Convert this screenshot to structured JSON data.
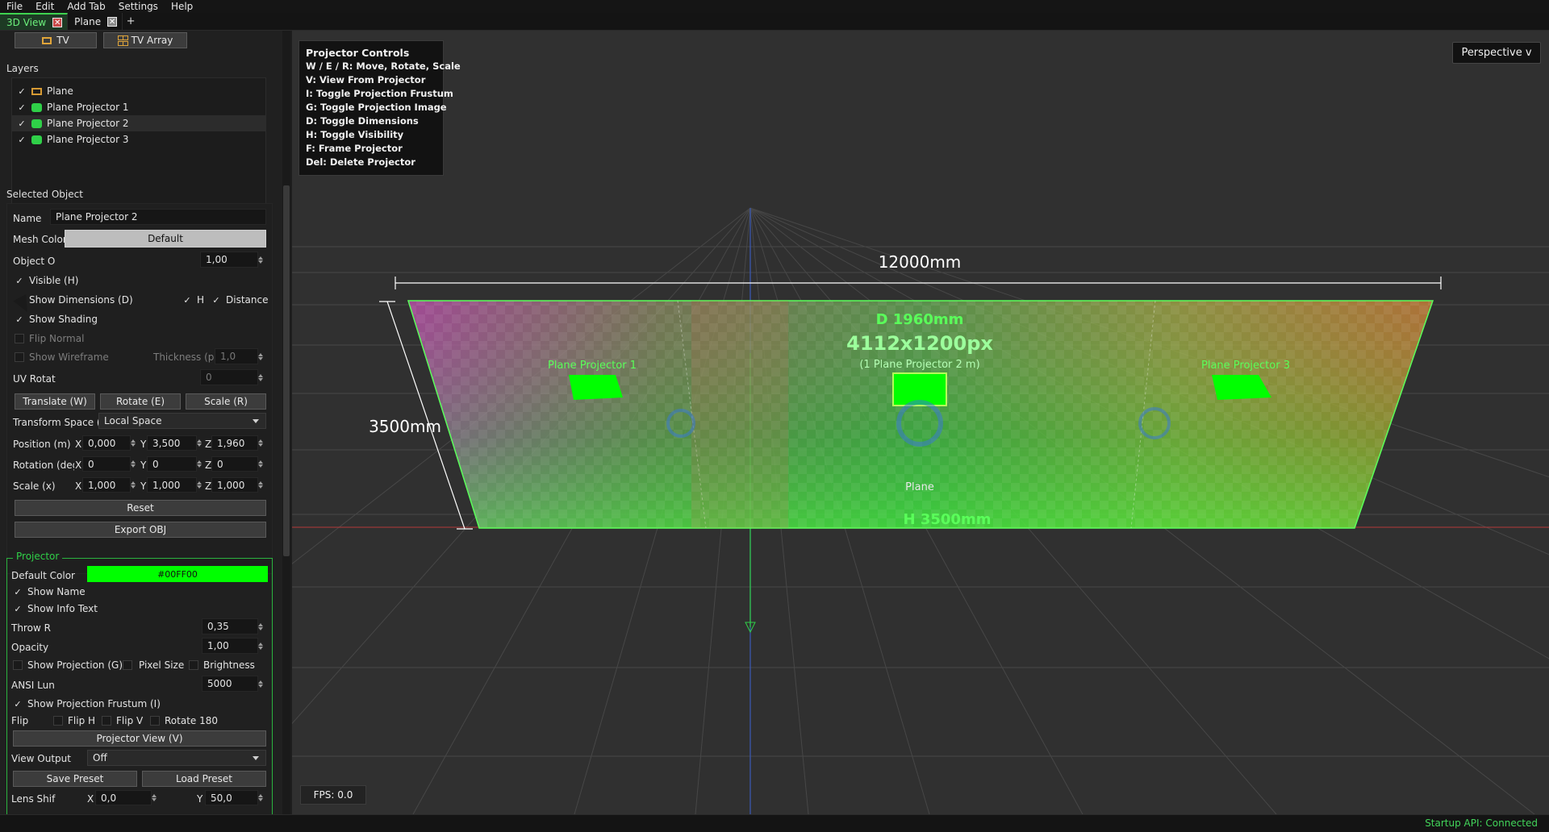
{
  "menu": [
    "File",
    "Edit",
    "Add Tab",
    "Settings",
    "Help"
  ],
  "tabs": [
    {
      "label": "3D View",
      "active": true
    },
    {
      "label": "Plane",
      "active": false
    }
  ],
  "tab_add_label": "+",
  "toolbar": {
    "tv_label": "TV",
    "tv_array_label": "TV Array"
  },
  "layers": {
    "title": "Layers",
    "items": [
      {
        "label": "Plane",
        "checked": true,
        "icon": "plane-layer-icon",
        "selected": false
      },
      {
        "label": "Plane Projector 1",
        "checked": true,
        "icon": "projector-icon",
        "selected": false
      },
      {
        "label": "Plane Projector 2",
        "checked": true,
        "icon": "projector-icon",
        "selected": true
      },
      {
        "label": "Plane Projector 3",
        "checked": true,
        "icon": "projector-icon",
        "selected": false
      }
    ]
  },
  "selected_object": {
    "title": "Selected Object",
    "name_label": "Name",
    "name_value": "Plane Projector 2",
    "mesh_color_label": "Mesh Color",
    "mesh_color_value": "Default",
    "object_opacity_label": "Object O",
    "object_opacity_value": "1,00",
    "visible_label": "Visible (H)",
    "show_dimensions_label": "Show Dimensions (D)",
    "h_label": "H",
    "distance_label": "Distance",
    "show_shading_label": "Show Shading",
    "flip_normal_label": "Flip Normal",
    "show_wireframe_label": "Show Wireframe",
    "thickness_label": "Thickness (px)",
    "thickness_value": "1,0",
    "uv_rotation_label": "UV Rotat",
    "uv_rotation_value": "0",
    "translate_label": "Translate (W)",
    "rotate_label": "Rotate (E)",
    "scale_label": "Scale (R)",
    "transform_space_label": "Transform Space (X)",
    "transform_space_value": "Local Space",
    "position_label": "Position (m)",
    "position": {
      "x": "0,000",
      "y": "3,500",
      "z": "1,960"
    },
    "rotation_label": "Rotation (deg)",
    "rotation": {
      "x": "0",
      "y": "0",
      "z": "0"
    },
    "scale_field_label": "Scale (x)",
    "scale": {
      "x": "1,000",
      "y": "1,000",
      "z": "1,000"
    },
    "axis_x": "X",
    "axis_y": "Y",
    "axis_z": "Z",
    "reset_label": "Reset",
    "export_label": "Export OBJ"
  },
  "projector": {
    "title": "Projector",
    "default_color_label": "Default Color",
    "default_color_value": "#00FF00",
    "default_color_hex": "#00ff00",
    "show_name_label": "Show Name",
    "show_info_text_label": "Show Info Text",
    "throw_ratio_label": "Throw R",
    "throw_ratio_value": "0,35",
    "opacity_label": "Opacity",
    "opacity_value": "1,00",
    "show_projection_label": "Show Projection (G)",
    "pixel_size_label": "Pixel Size",
    "brightness_label": "Brightness",
    "ansi_label": "ANSI Lun",
    "ansi_value": "5000",
    "show_frustum_label": "Show Projection Frustum (I)",
    "flip_label": "Flip",
    "flip_h_label": "Flip H",
    "flip_v_label": "Flip V",
    "rotate180_label": "Rotate 180",
    "projector_view_label": "Projector View (V)",
    "view_output_label": "View Output",
    "view_output_value": "Off",
    "save_preset_label": "Save Preset",
    "load_preset_label": "Load Preset",
    "lens_shift_label": "Lens Shif",
    "lens_shift_x": "0,0",
    "lens_shift_y": "50,0"
  },
  "viewport": {
    "controls_title": "Projector Controls",
    "controls": [
      "W / E / R: Move, Rotate, Scale",
      "V: View From Projector",
      "I: Toggle Projection Frustum",
      "G: Toggle Projection Image",
      "D: Toggle Dimensions",
      "H: Toggle Visibility",
      "F: Frame Projector",
      "Del: Delete Projector"
    ],
    "perspective_label": "Perspective v",
    "fps_label": "FPS: 0.0",
    "width_dimension": "12000mm",
    "height_dimension": "3500mm",
    "depth_label": "D 1960mm",
    "resolution_label": "4112x1200px",
    "projector_sub_label": "(1 Plane Projector 2 m)",
    "plane_label": "Plane",
    "h_dimension": "H 3500mm",
    "projector_labels": [
      "Plane Projector 1",
      "Plane Projector 3"
    ],
    "accent": "#00ff00"
  },
  "status": {
    "text": "Startup API: Connected",
    "color": "#42d55a"
  }
}
